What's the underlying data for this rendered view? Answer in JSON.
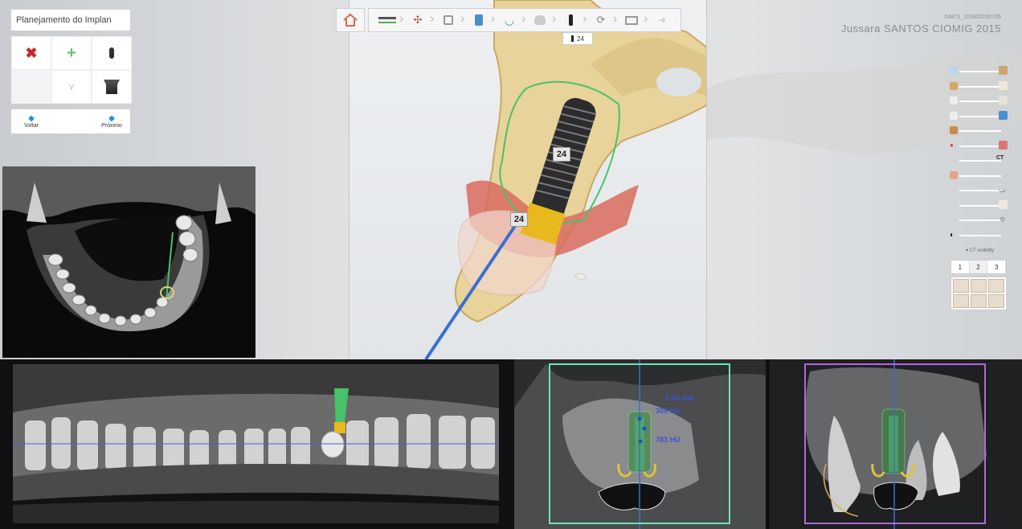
{
  "panel": {
    "title": "Planejamento do Implan",
    "back_label": "Voltar",
    "next_label": "Próximo"
  },
  "toolbar": {
    "implant_number": "24"
  },
  "patient": {
    "id": "04871_102820150726",
    "name": "Jussara SANTOS CIOMIG 2015"
  },
  "viewer": {
    "implant_label_top": "24",
    "implant_label_bottom": "24"
  },
  "sidebar": {
    "ct_label": "CT",
    "ct_visibility_label": "CT visibility",
    "view_tabs": [
      "1",
      "2",
      "3"
    ]
  },
  "cross_section": {
    "measure_mm": "1.20 mm",
    "hu_top": "308 HU",
    "hu_bottom": "783 HU"
  },
  "colors": {
    "bone": "#e8d39a",
    "implant_core": "#2c2c2e",
    "guide_green": "#47c26a",
    "axis_blue": "#3a6fd2",
    "cross_frame_green": "#6fe3b4",
    "tangential_frame_magenta": "#b067d9"
  }
}
